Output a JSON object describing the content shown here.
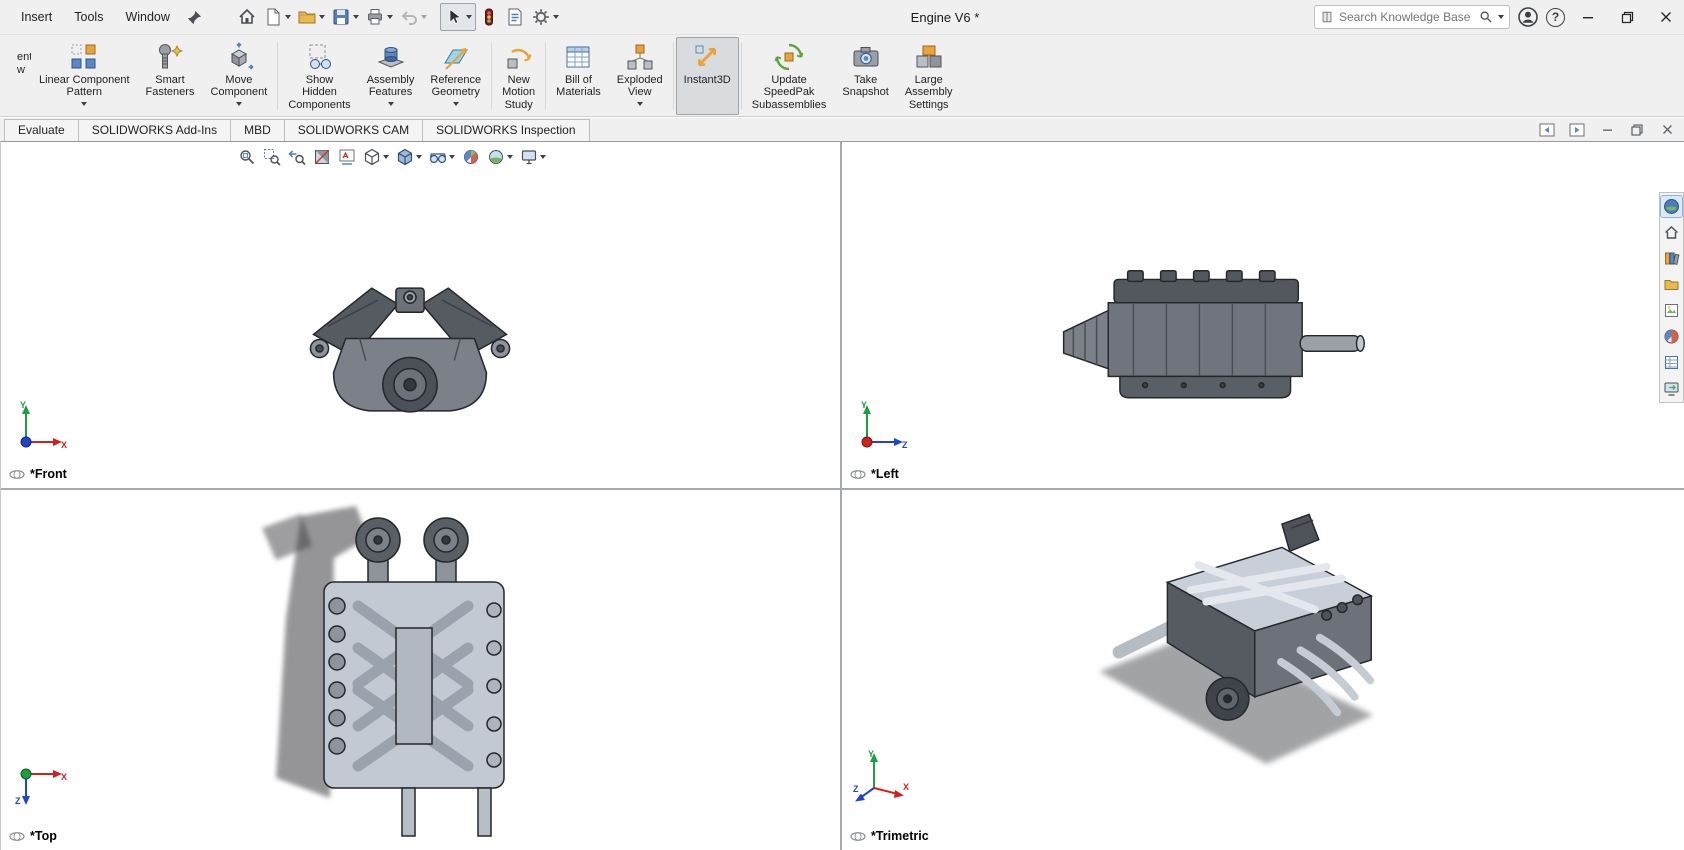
{
  "titlebar": {
    "menus": [
      "Insert",
      "Tools",
      "Window"
    ],
    "title": "Engine V6 *",
    "search": {
      "placeholder": "Search Knowledge Base"
    },
    "help_glyph": "?",
    "quick_access_icons": [
      "home",
      "new-document",
      "open",
      "save",
      "print",
      "undo",
      "select-cursor",
      "rebuild",
      "file-properties",
      "options"
    ]
  },
  "ribbon": {
    "clipped_label_fragments": [
      "ent",
      "w"
    ],
    "buttons": [
      {
        "label": "Linear Component\nPattern",
        "dropdown": true
      },
      {
        "label": "Smart\nFasteners",
        "dropdown": false
      },
      {
        "label": "Move\nComponent",
        "dropdown": true
      },
      {
        "label": "Show\nHidden\nComponents",
        "dropdown": false
      },
      {
        "label": "Assembly\nFeatures",
        "dropdown": true
      },
      {
        "label": "Reference\nGeometry",
        "dropdown": true
      },
      {
        "label": "New\nMotion\nStudy",
        "dropdown": false
      },
      {
        "label": "Bill of\nMaterials",
        "dropdown": false
      },
      {
        "label": "Exploded\nView",
        "dropdown": true
      },
      {
        "label": "Instant3D",
        "dropdown": false,
        "active": true
      },
      {
        "label": "Update\nSpeedPak\nSubassemblies",
        "dropdown": false
      },
      {
        "label": "Take\nSnapshot",
        "dropdown": false
      },
      {
        "label": "Large\nAssembly\nSettings",
        "dropdown": false
      }
    ]
  },
  "command_tabs": [
    "Evaluate",
    "SOLIDWORKS Add-Ins",
    "MBD",
    "SOLIDWORKS CAM",
    "SOLIDWORKS Inspection"
  ],
  "hud_icons": [
    "zoom-to-fit",
    "zoom-to-area",
    "previous-view",
    "section-view",
    "dynamic-annotation-views",
    "view-orientation",
    "display-style",
    "hide-show-items",
    "edit-appearance",
    "apply-scene",
    "view-settings"
  ],
  "viewports": [
    {
      "label": "*Front"
    },
    {
      "label": "*Left"
    },
    {
      "label": "*Top"
    },
    {
      "label": "*Trimetric"
    }
  ],
  "axes": {
    "x": "X",
    "y": "Y",
    "z": "Z"
  },
  "task_pane_icons": [
    "solidworks-resources",
    "home",
    "design-library",
    "file-explorer",
    "view-palette",
    "appearances-scenes",
    "custom-properties",
    "solidworks-forum"
  ],
  "colors": {
    "chrome_bg": "#f0f0f0",
    "active_button_bg": "#d9dcdf",
    "viewport_bg": "#ffffff",
    "axis_x": "#cc2222",
    "axis_y": "#1e9e3e",
    "axis_z": "#2244cc"
  }
}
